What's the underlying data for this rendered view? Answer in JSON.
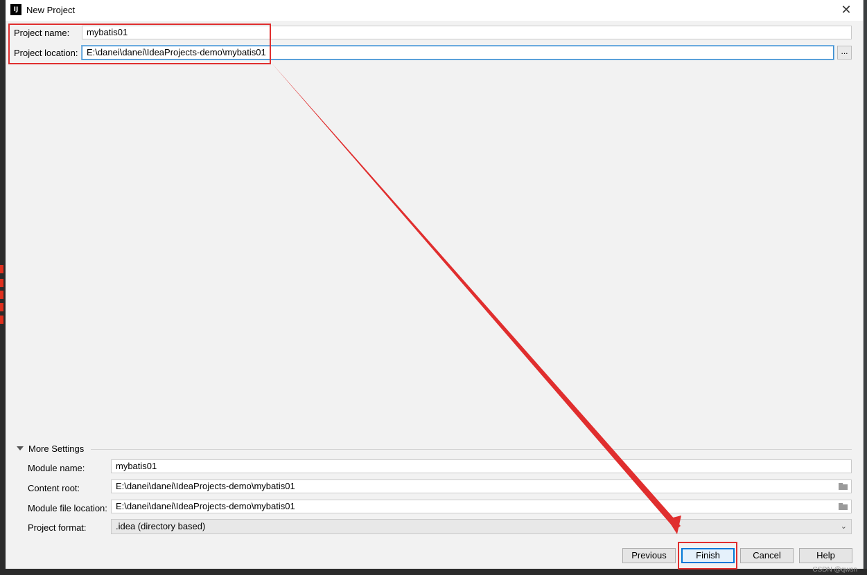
{
  "window": {
    "title": "New Project",
    "logo_text": "IJ",
    "close_glyph": "✕"
  },
  "project": {
    "name_label": "Project name:",
    "name_value": "mybatis01",
    "location_label": "Project location:",
    "location_value": "E:\\danei\\danei\\IdeaProjects-demo\\mybatis01",
    "browse_label": "..."
  },
  "more_settings": {
    "title": "More Settings",
    "module_name_label": "Module name:",
    "module_name_value": "mybatis01",
    "content_root_label": "Content root:",
    "content_root_value": "E:\\danei\\danei\\IdeaProjects-demo\\mybatis01",
    "module_file_label": "Module file location:",
    "module_file_value": "E:\\danei\\danei\\IdeaProjects-demo\\mybatis01",
    "project_format_label": "Project format:",
    "project_format_value": ".idea (directory based)",
    "dropdown_glyph": "⌄"
  },
  "buttons": {
    "previous": "Previous",
    "finish": "Finish",
    "cancel": "Cancel",
    "help": "Help"
  },
  "watermark": "CSDN @qwsn",
  "icons": [
    "app-logo-icon",
    "close-icon",
    "collapse-triangle-icon",
    "folder-icon",
    "chevron-down-icon"
  ],
  "colors": {
    "annotation": "#e02e2e",
    "focus": "#0078d7",
    "dialog_bg": "#f2f2f2"
  }
}
